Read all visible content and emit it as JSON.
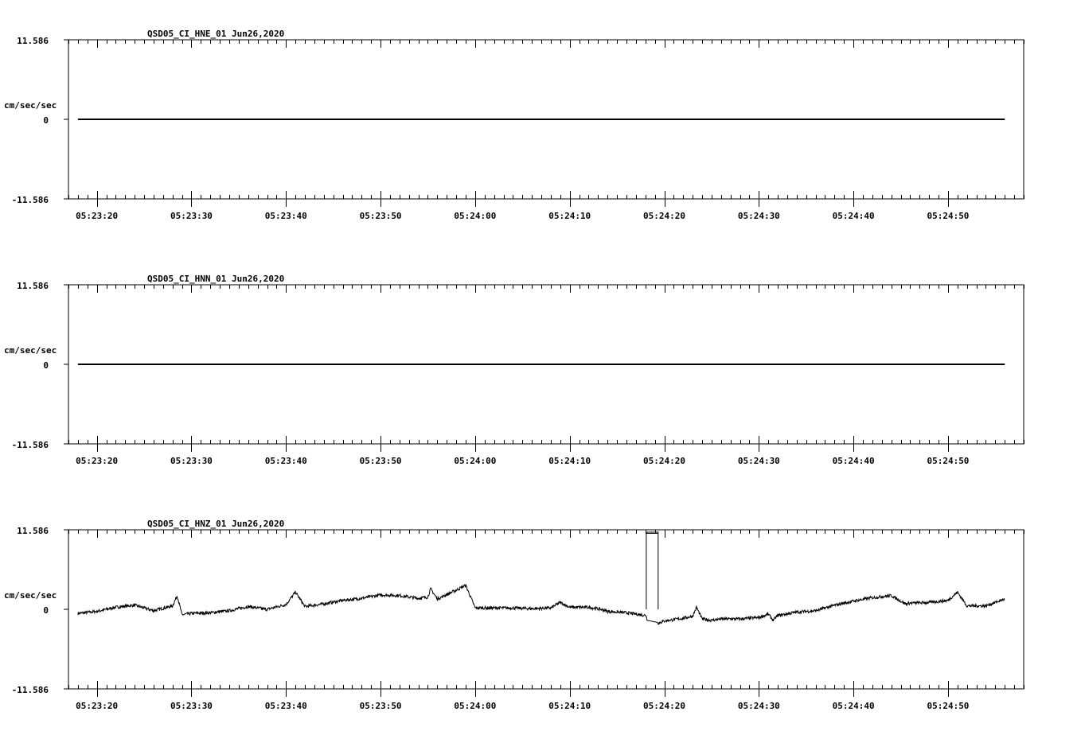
{
  "chart_data": [
    {
      "type": "line",
      "title": "QSD05_CI_HNE_01  Jun26,2020",
      "ylabel": "cm/sec/sec",
      "ylim": [
        -11.586,
        11.586
      ],
      "yticks": [
        "11.586",
        "0",
        "-11.586"
      ],
      "x_tick_labels": [
        "05:23:20",
        "05:23:30",
        "05:23:40",
        "05:23:50",
        "05:24:00",
        "05:24:10",
        "05:24:20",
        "05:24:30",
        "05:24:40",
        "05:24:50"
      ],
      "x_range_s": [
        -3,
        98
      ],
      "x_data_range_s": [
        -2,
        96
      ],
      "series": [
        {
          "x_s": [
            -2,
            96
          ],
          "y": [
            0,
            0
          ]
        }
      ]
    },
    {
      "type": "line",
      "title": "QSD05_CI_HNN_01  Jun26,2020",
      "ylabel": "cm/sec/sec",
      "ylim": [
        -11.586,
        11.586
      ],
      "yticks": [
        "11.586",
        "0",
        "-11.586"
      ],
      "x_tick_labels": [
        "05:23:20",
        "05:23:30",
        "05:23:40",
        "05:23:50",
        "05:24:00",
        "05:24:10",
        "05:24:20",
        "05:24:30",
        "05:24:40",
        "05:24:50"
      ],
      "x_range_s": [
        -3,
        98
      ],
      "x_data_range_s": [
        -2,
        96
      ],
      "series": [
        {
          "x_s": [
            -2,
            96
          ],
          "y": [
            0,
            0
          ]
        }
      ]
    },
    {
      "type": "line",
      "title": "QSD05_CI_HNZ_01  Jun26,2020",
      "ylabel": "cm/sec/sec",
      "ylim": [
        -11.586,
        11.586
      ],
      "yticks": [
        "11.586",
        "0",
        "-11.586"
      ],
      "x_tick_labels": [
        "05:23:20",
        "05:23:30",
        "05:23:40",
        "05:23:50",
        "05:24:00",
        "05:24:10",
        "05:24:20",
        "05:24:30",
        "05:24:40",
        "05:24:50"
      ],
      "x_range_s": [
        -3,
        98
      ],
      "x_data_range_s": [
        -2,
        96
      ],
      "series": [
        {
          "x_s": [
            -2,
            0,
            2,
            4,
            6,
            8,
            8.5,
            9,
            10,
            12,
            14,
            16,
            18,
            20,
            21,
            22,
            24,
            26,
            28,
            30,
            32,
            34,
            35,
            35.3,
            36,
            38,
            39,
            40,
            42,
            44,
            46,
            48,
            49,
            50,
            52,
            53.3,
            54,
            56,
            58.1,
            58.15,
            59.3,
            59.35,
            60,
            62,
            63,
            63.4,
            64,
            65,
            66,
            68,
            70,
            71,
            71.5,
            72,
            74,
            76,
            78,
            80,
            82,
            84,
            85.5,
            86,
            88,
            90,
            91,
            92,
            94,
            96
          ],
          "y": [
            -0.6,
            -0.3,
            0.3,
            0.6,
            -0.2,
            0.5,
            2.0,
            -0.8,
            -0.6,
            -0.5,
            -0.2,
            0.4,
            0.0,
            0.7,
            2.5,
            0.4,
            0.8,
            1.3,
            1.6,
            2.1,
            2.0,
            1.6,
            1.8,
            3.0,
            1.5,
            2.8,
            3.5,
            0.2,
            0.2,
            0.2,
            0.1,
            0.2,
            1.0,
            0.3,
            0.3,
            0.0,
            -0.3,
            -0.5,
            -0.9,
            -1.6,
            -1.9,
            -2.0,
            -1.7,
            -1.3,
            -1.0,
            0.3,
            -1.4,
            -1.6,
            -1.4,
            -1.4,
            -1.2,
            -0.7,
            -1.6,
            -0.9,
            -0.4,
            -0.2,
            0.6,
            1.2,
            1.7,
            2.0,
            0.8,
            0.9,
            1.0,
            1.3,
            2.5,
            0.5,
            0.5,
            1.5
          ]
        }
      ]
    }
  ]
}
